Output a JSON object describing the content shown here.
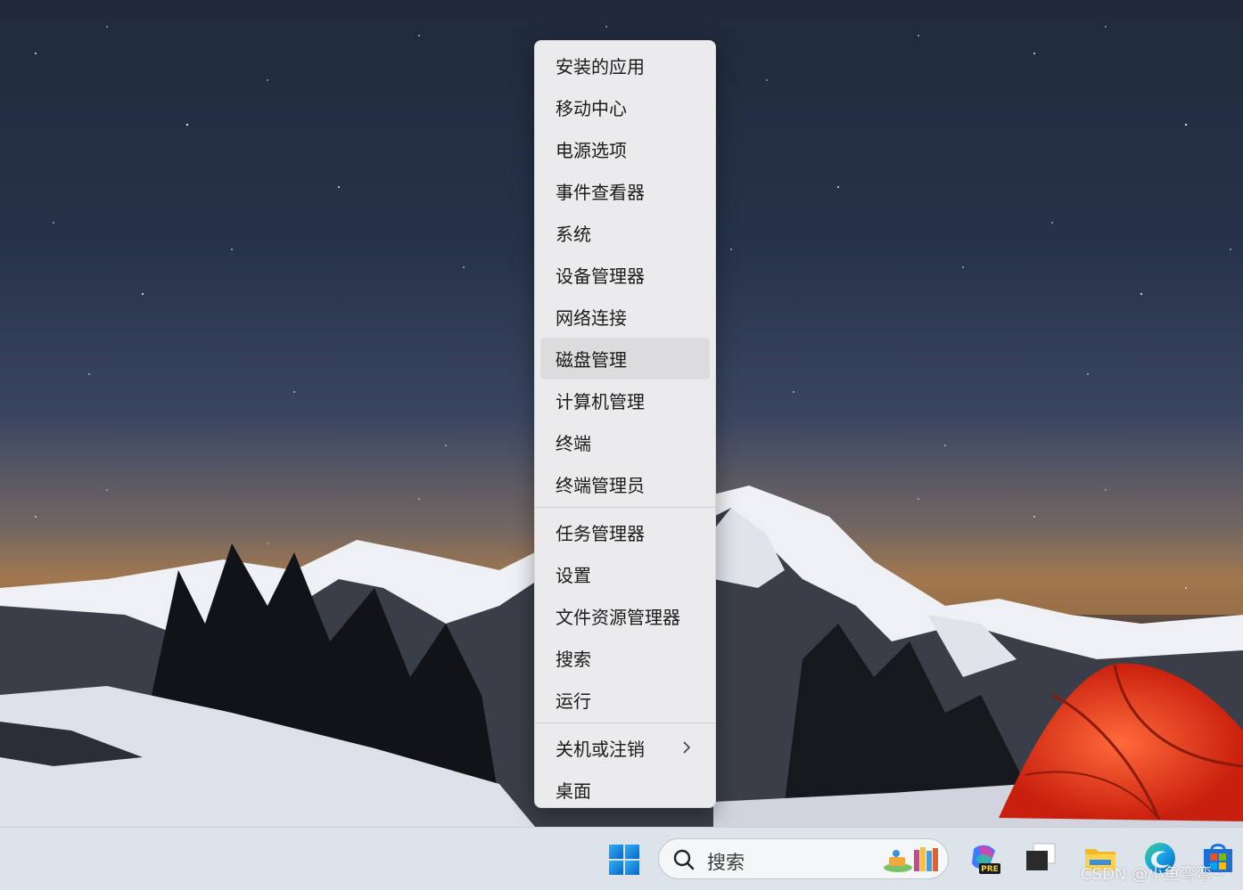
{
  "context_menu": {
    "groups": [
      [
        {
          "label": "安装的应用"
        },
        {
          "label": "移动中心"
        },
        {
          "label": "电源选项"
        },
        {
          "label": "事件查看器"
        },
        {
          "label": "系统"
        },
        {
          "label": "设备管理器"
        },
        {
          "label": "网络连接"
        },
        {
          "label": "磁盘管理"
        },
        {
          "label": "计算机管理"
        },
        {
          "label": "终端"
        },
        {
          "label": "终端管理员"
        }
      ],
      [
        {
          "label": "任务管理器"
        },
        {
          "label": "设置"
        },
        {
          "label": "文件资源管理器"
        },
        {
          "label": "搜索"
        },
        {
          "label": "运行"
        }
      ],
      [
        {
          "label": "关机或注销"
        },
        {
          "label": "桌面"
        }
      ]
    ],
    "hovered_item": "磁盘管理"
  },
  "taskbar": {
    "search_placeholder": "搜索",
    "pinned_icons": [
      "windows-start-icon",
      "copilot-pre-icon",
      "task-view-icon",
      "file-explorer-icon",
      "edge-icon",
      "microsoft-store-icon"
    ]
  },
  "watermark": "CSDN @小鱼弯弯~",
  "colors": {
    "menu_bg": "#ebebed",
    "menu_hover": "#dcdcde",
    "taskbar_bg": "#dde3ea",
    "windows_blue": "#0a78d7",
    "tent_red": "#e8331b"
  }
}
